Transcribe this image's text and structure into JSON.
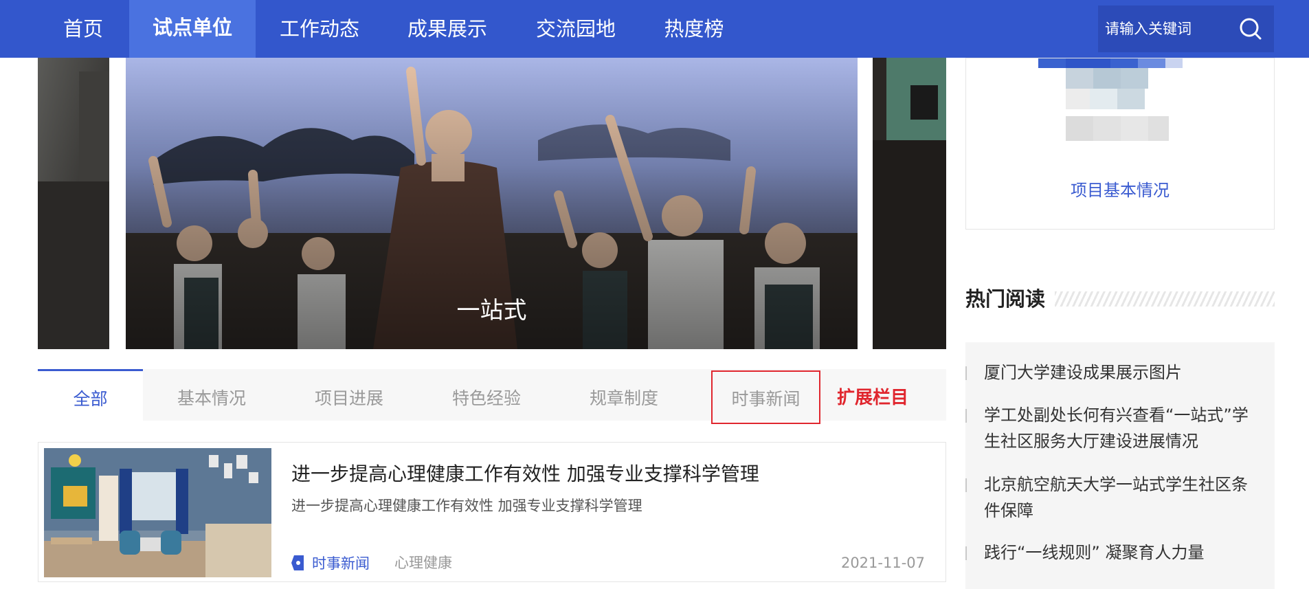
{
  "nav": {
    "items": [
      {
        "label": "首页"
      },
      {
        "label": "试点单位",
        "active": true
      },
      {
        "label": "工作动态"
      },
      {
        "label": "成果展示"
      },
      {
        "label": "交流园地"
      },
      {
        "label": "热度榜"
      }
    ],
    "search": {
      "placeholder": "请输入关键词",
      "icon": "search-icon"
    }
  },
  "carousel": {
    "caption": "一站式"
  },
  "tabs": {
    "items": [
      {
        "label": "全部",
        "active": true
      },
      {
        "label": "基本情况"
      },
      {
        "label": "项目进展"
      },
      {
        "label": "特色经验"
      },
      {
        "label": "规章制度"
      },
      {
        "label": "时事新闻",
        "highlighted": true
      }
    ],
    "extend_label": "扩展栏目"
  },
  "article": {
    "title": "进一步提高心理健康工作有效性 加强专业支撑科学管理",
    "summary": "进一步提高心理健康工作有效性 加强专业支撑科学管理",
    "tag": "时事新闻",
    "category": "心理健康",
    "date": "2021-11-07"
  },
  "project": {
    "link": "项目基本情况"
  },
  "hot": {
    "title": "热门阅读",
    "items": [
      {
        "title": "厦门大学建设成果展示图片"
      },
      {
        "title": "学工处副处长何有兴查看“一站式”学生社区服务大厅建设进展情况"
      },
      {
        "title": "北京航空航天大学一站式学生社区条件保障"
      },
      {
        "title": "践行“一线规则” 凝聚育人力量"
      }
    ]
  },
  "colors": {
    "nav_bg": "#3357cc",
    "nav_active": "#4a72e0",
    "accent_blue": "#3a5bd0",
    "accent_red": "#e0262e"
  }
}
